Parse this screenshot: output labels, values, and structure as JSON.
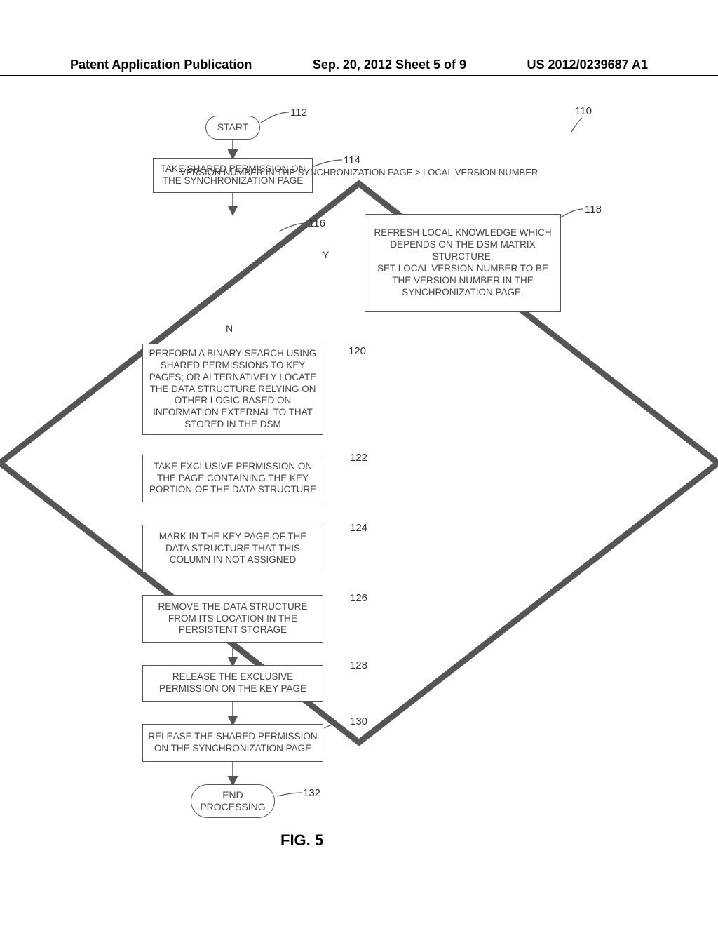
{
  "header": {
    "left": "Patent Application Publication",
    "center": "Sep. 20, 2012  Sheet 5 of 9",
    "right": "US 2012/0239687 A1"
  },
  "refs": {
    "r110": "110",
    "r112": "112",
    "r114": "114",
    "r116": "116",
    "r118": "118",
    "r120": "120",
    "r122": "122",
    "r124": "124",
    "r126": "126",
    "r128": "128",
    "r130": "130",
    "r132": "132"
  },
  "labels": {
    "y": "Y",
    "n": "N"
  },
  "nodes": {
    "start": "START",
    "n114": "TAKE SHARED PERMISSION ON THE SYNCHRONIZATION PAGE",
    "n116": "VERSION NUMBER IN THE SYNCHRONIZATION PAGE > LOCAL VERSION NUMBER",
    "n118": "REFRESH LOCAL KNOWLEDGE WHICH DEPENDS ON THE DSM MATRIX STURCTURE.\nSET LOCAL VERSION NUMBER TO BE THE VERSION NUMBER IN THE SYNCHRONIZATION PAGE.",
    "n120": "PERFORM A BINARY SEARCH USING SHARED PERMISSIONS TO KEY PAGES; OR ALTERNATIVELY LOCATE THE DATA STRUCTURE RELYING ON OTHER LOGIC BASED ON INFORMATION EXTERNAL TO THAT STORED IN THE DSM",
    "n122": "TAKE EXCLUSIVE PERMISSION ON THE PAGE CONTAINING THE KEY PORTION OF THE DATA STRUCTURE",
    "n124": "MARK IN THE KEY PAGE OF THE DATA STRUCTURE THAT THIS COLUMN IN NOT ASSIGNED",
    "n126": "REMOVE THE DATA STRUCTURE FROM ITS LOCATION IN THE PERSISTENT STORAGE",
    "n128": "RELEASE THE EXCLUSIVE PERMISSION ON THE KEY PAGE",
    "n130": "RELEASE THE SHARED PERMISSION ON THE SYNCHRONIZATION PAGE",
    "end": "END PROCESSING"
  },
  "figure": "FIG. 5"
}
